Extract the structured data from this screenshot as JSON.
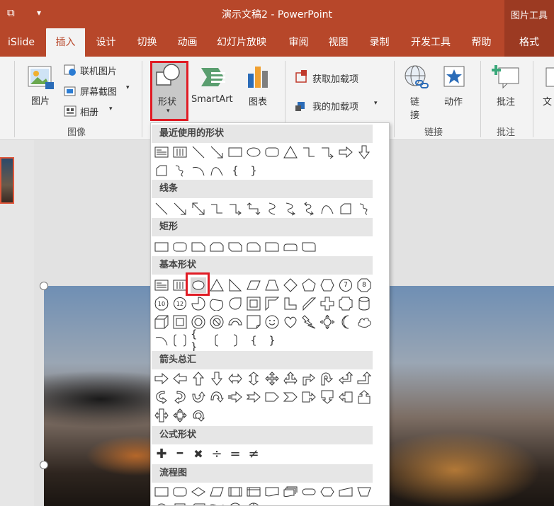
{
  "titlebar": {
    "title": "演示文稿2  -  PowerPoint",
    "context_group": "图片工具",
    "qa_present": "⧉",
    "qa_more": "▾"
  },
  "tabs": [
    "iSlide",
    "插入",
    "设计",
    "切换",
    "动画",
    "幻灯片放映",
    "审阅",
    "视图",
    "录制",
    "开发工具",
    "帮助"
  ],
  "format_tab": "格式",
  "ribbon": {
    "picture": "图片",
    "online_picture": "联机图片",
    "screenshot": "屏幕截图",
    "album": "相册",
    "images_group": "图像",
    "shapes": "形状",
    "smartart": "SmartArt",
    "chart": "图表",
    "get_addins": "获取加载项",
    "my_addins": "我的加载项",
    "link_line1": "链",
    "link_line2": "接",
    "action": "动作",
    "links_group": "链接",
    "comment": "批注",
    "comments_group": "批注",
    "text_partial": "文"
  },
  "dropdown": {
    "categories": [
      "最近使用的形状",
      "线条",
      "矩形",
      "基本形状",
      "箭头总汇",
      "公式形状",
      "流程图"
    ],
    "text_shapes": {
      "brace_open": "{",
      "brace_close": "}",
      "braces": "{ }",
      "plus": "✚",
      "minus": "━",
      "multiply": "✖",
      "divide": "÷",
      "equal": "=",
      "not_equal": "≠",
      "num7": "7",
      "num8": "8",
      "num10": "10",
      "num12": "12"
    }
  }
}
